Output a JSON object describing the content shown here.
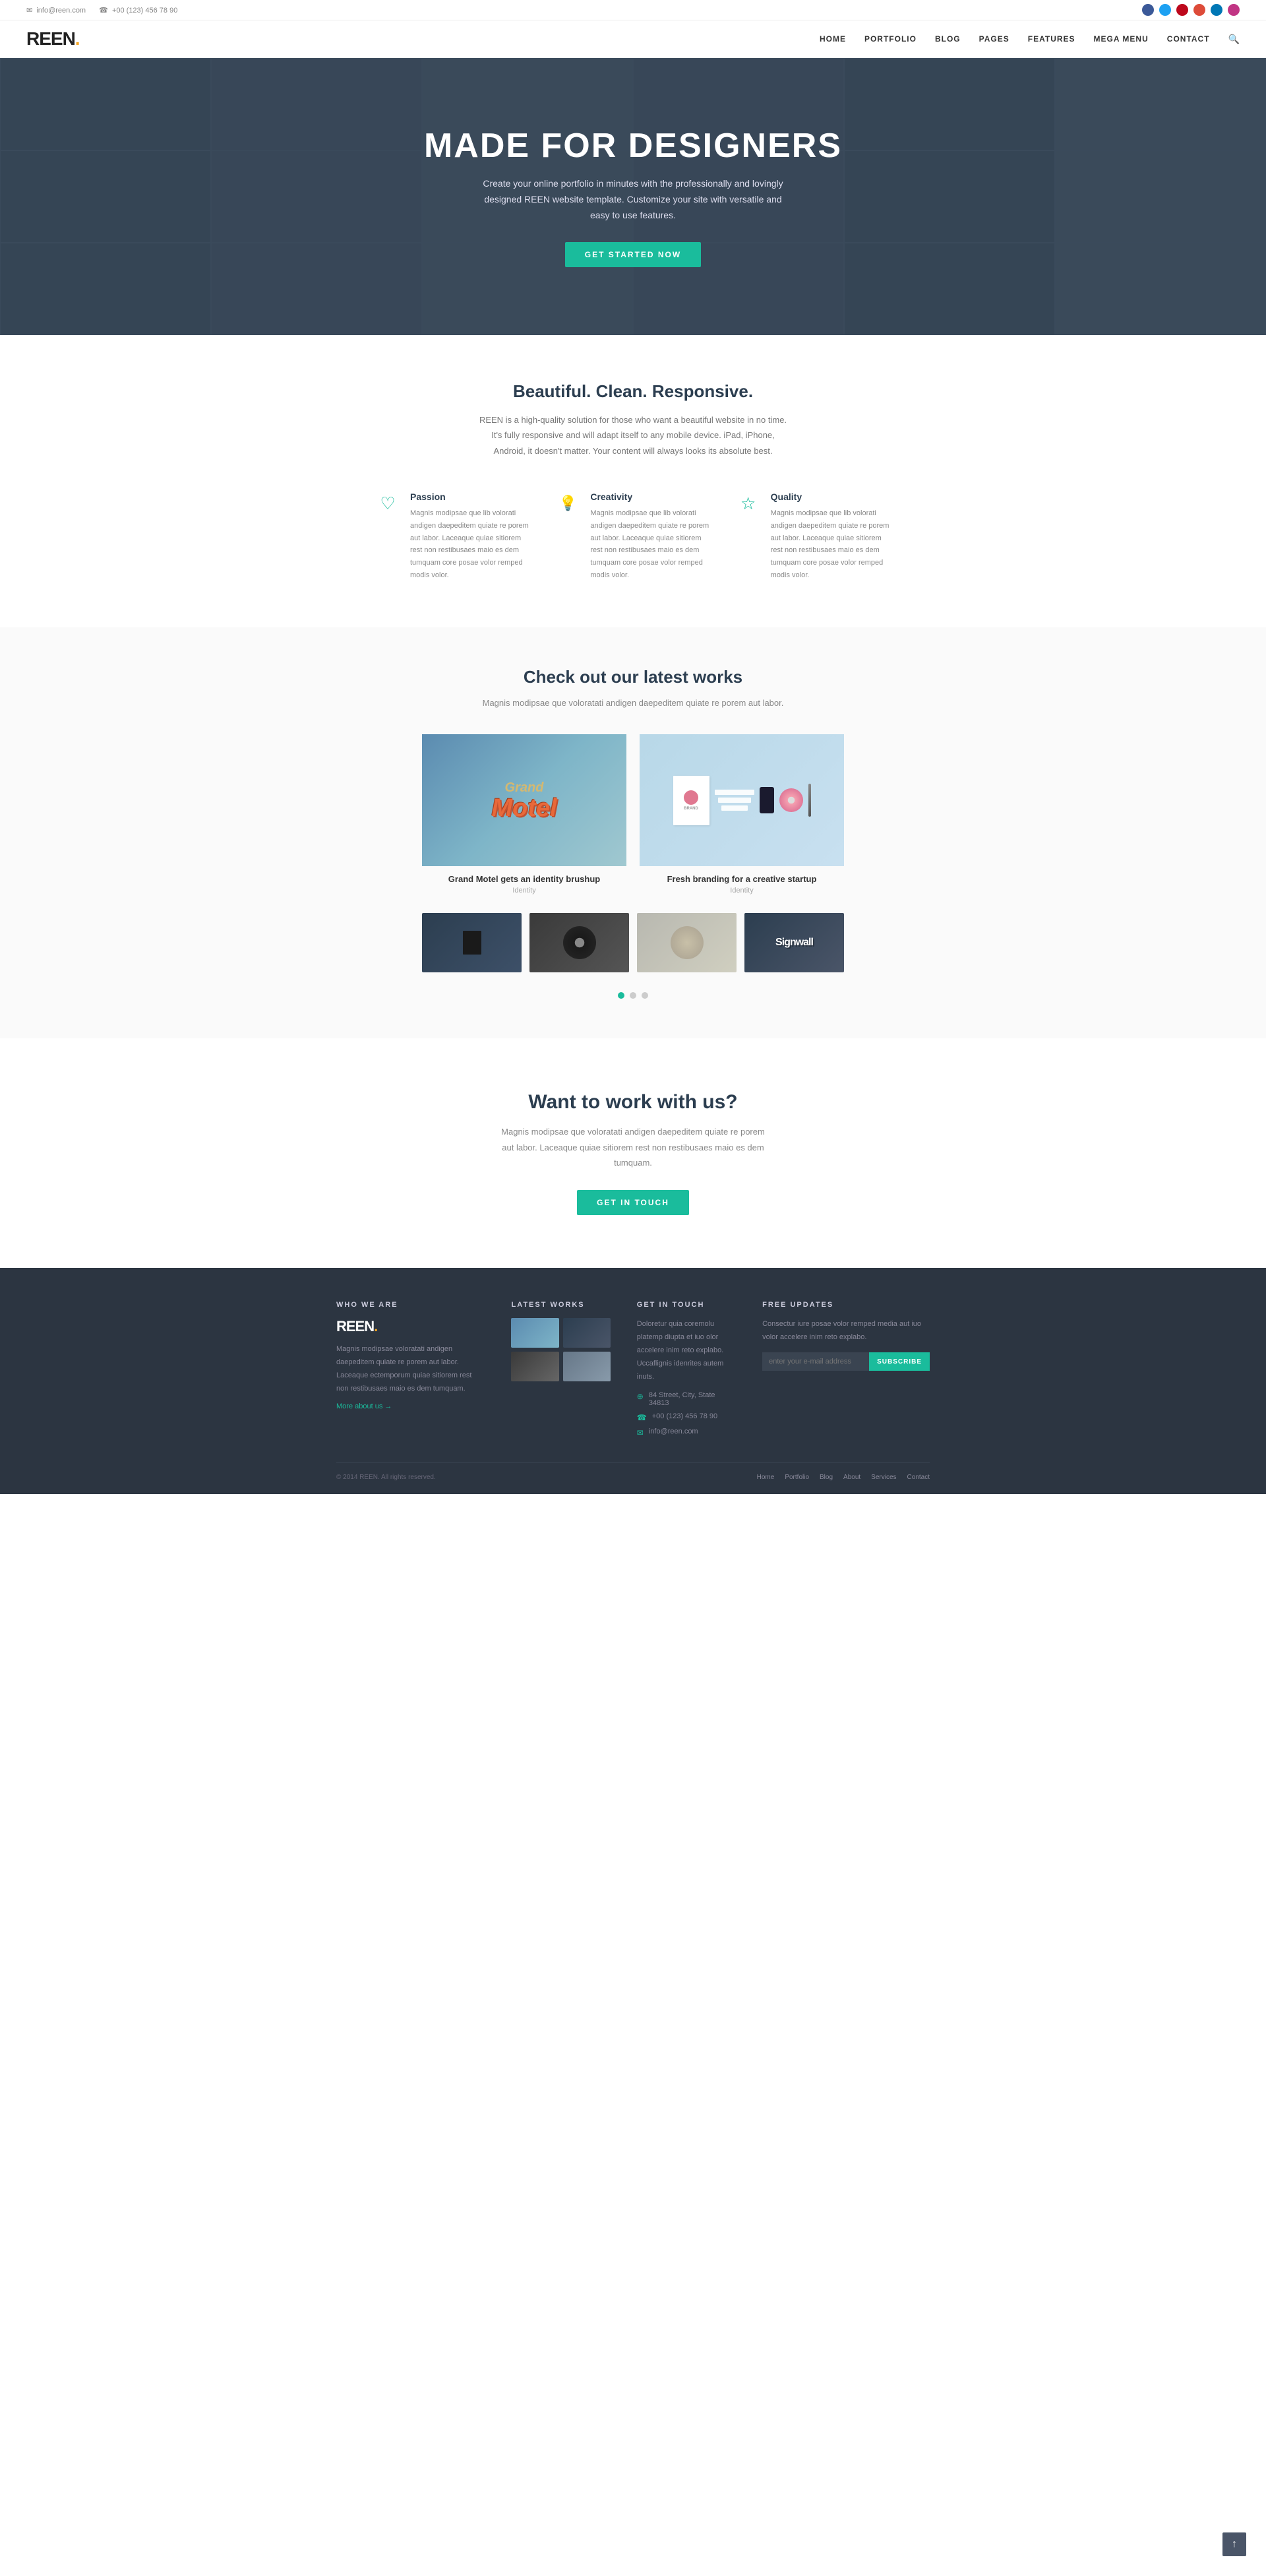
{
  "topbar": {
    "email_icon": "✉",
    "email": "info@reen.com",
    "phone_icon": "☎",
    "phone": "+00 (123) 456 78 90"
  },
  "header": {
    "logo": "REEN.",
    "nav": {
      "home": "HOME",
      "portfolio": "PORTFOLIO",
      "blog": "BLOG",
      "pages": "PAGES",
      "features": "FEATURES",
      "mega_menu": "MEGA MENU",
      "contact": "CONTACT"
    }
  },
  "hero": {
    "title": "MADE FOR DESIGNERS",
    "subtitle": "Create your online portfolio in minutes with the professionally and lovingly designed REEN website template. Customize your site with versatile and easy to use features.",
    "cta": "GET STARTED NOW"
  },
  "features_section": {
    "title": "Beautiful. Clean. Responsive.",
    "subtitle": "REEN is a high-quality solution for those who want a beautiful website in no time.\nIt's fully responsive and will adapt itself to any mobile device. iPad, iPhone, Android,\nit doesn't matter. Your content will always looks its absolute best.",
    "items": [
      {
        "icon": "♡",
        "title": "Passion",
        "text": "Magnis modipsae que lib volorati andigen daepeditem quiate re porem aut labor. Laceaque quiae sitiorem rest non restibusaes maio es dem tumquam core posae volor remped modis volor."
      },
      {
        "icon": "💡",
        "title": "Creativity",
        "text": "Magnis modipsae que lib volorati andigen daepeditem quiate re porem aut labor. Laceaque quiae sitiorem rest non restibusaes maio es dem tumquam core posae volor remped modis volor."
      },
      {
        "icon": "☆",
        "title": "Quality",
        "text": "Magnis modipsae que lib volorati andigen daepeditem quiate re porem aut labor. Laceaque quiae sitiorem rest non restibusaes maio es dem tumquam core posae volor remped modis volor."
      }
    ]
  },
  "portfolio_section": {
    "title": "Check out our latest works",
    "subtitle": "Magnis modipsae que voloratati andigen daepeditem quiate re porem aut labor.",
    "main_items": [
      {
        "label": "Grand Motel gets an identity brushup",
        "category": "Identity"
      },
      {
        "label": "Fresh branding for a creative startup",
        "category": "Identity"
      }
    ],
    "dots": [
      "active",
      "inactive",
      "inactive"
    ]
  },
  "cta_section": {
    "title": "Want to work with us?",
    "text": "Magnis modipsae que voloratati andigen daepeditem quiate re porem aut labor.\nLaceaque quiae sitiorem rest non restibusaes maio es dem tumquam.",
    "button": "GET IN TOUCH"
  },
  "footer": {
    "who_we_are": {
      "title": "WHO WE ARE",
      "logo": "REEN.",
      "text": "Magnis modipsae voloratati andigen daepeditem quiate re porem aut labor. Laceaque ectemporum quiae sitiorem rest non restibusaes maio es dem tumquam.",
      "link": "More about us →"
    },
    "latest_works": {
      "title": "LATEST WORKS"
    },
    "get_in_touch": {
      "title": "GET IN TOUCH",
      "description": "Doloretur quia coremolu platemp diupta et iuo olor accelere inim reto explabo. Uccaflignis idenrites autem inuts.",
      "address_icon": "⊕",
      "address": "84 Street, City, State 34813",
      "phone_icon": "☎",
      "phone": "+00 (123) 456 78 90",
      "email_icon": "✉",
      "email": "info@reen.com"
    },
    "free_updates": {
      "title": "FREE UPDATES",
      "text": "Consectur iure posae volor remped media aut iuo volor accelere inim reto explabo.",
      "input_placeholder": "enter your e-mail address",
      "subscribe": "SUBSCRIBE"
    },
    "bottom": {
      "copyright": "© 2014 REEN. All rights reserved.",
      "nav": [
        "Home",
        "Portfolio",
        "Blog",
        "About",
        "Services",
        "Contact"
      ]
    }
  }
}
